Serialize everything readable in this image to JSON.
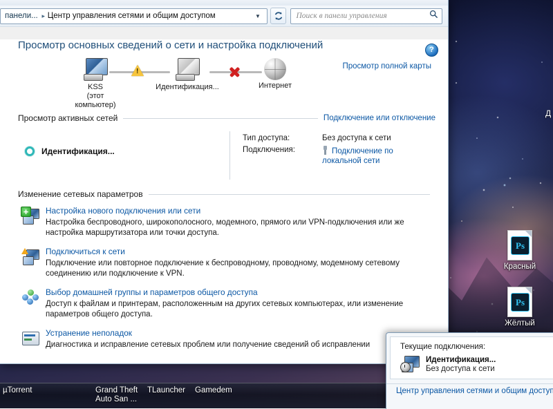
{
  "window": {
    "address": {
      "crumb_prefix": "панели...",
      "crumb_separator": "▸",
      "crumb_current": "Центр управления сетями и общим доступом",
      "dropdown_icon": "chevron-down-icon",
      "refresh_icon": "refresh-icon"
    },
    "search": {
      "placeholder": "Поиск в панели управления",
      "icon": "search-icon"
    },
    "help_label": "?",
    "page_title": "Просмотр основных сведений о сети и настройка подключений"
  },
  "netmap": {
    "full_map_link": "Просмотр полной карты",
    "nodes": [
      {
        "caption": "KSS\n(этот компьютер)",
        "icon": "computer-icon"
      },
      {
        "caption": "Идентификация...",
        "icon": "multiple-computers-icon"
      },
      {
        "caption": "Интернет",
        "icon": "globe-icon"
      }
    ],
    "link_status": [
      {
        "icon": "warning-icon",
        "label": "warning"
      },
      {
        "icon": "red-x-icon",
        "label": "no-connection"
      }
    ]
  },
  "active_networks": {
    "heading": "Просмотр активных сетей",
    "side_link": "Подключение или отключение",
    "network_name": "Идентификация...",
    "network_icon": "identifying-ring-icon",
    "rows": [
      {
        "key": "Тип доступа:",
        "value": "Без доступа к сети",
        "is_link": false
      },
      {
        "key": "Подключения:",
        "value": "Подключение по локальной сети",
        "is_link": true,
        "icon": "network-plug-icon"
      }
    ]
  },
  "settings": {
    "heading": "Изменение сетевых параметров",
    "items": [
      {
        "icon": "new-connection-icon",
        "title": "Настройка нового подключения или сети",
        "desc": "Настройка беспроводного, широкополосного, модемного, прямого или VPN-подключения или же настройка маршрутизатора или точки доступа."
      },
      {
        "icon": "connect-to-network-icon",
        "title": "Подключиться к сети",
        "desc": "Подключение или повторное подключение к беспроводному, проводному, модемному сетевому соединению или подключение к VPN."
      },
      {
        "icon": "homegroup-icon",
        "title": "Выбор домашней группы и параметров общего доступа",
        "desc": "Доступ к файлам и принтерам, расположенным на других сетевых компьютерах, или изменение параметров общего доступа."
      },
      {
        "icon": "troubleshoot-icon",
        "title": "Устранение неполадок",
        "desc": "Диагностика и исправление сетевых проблем или получение сведений об исправлении"
      }
    ]
  },
  "flyout": {
    "heading": "Текущие подключения:",
    "connection_name": "Идентификация...",
    "connection_status": "Без доступа к сети",
    "connection_icon": "network-connection-icon",
    "footer_link": "Центр управления сетями и общим доступу"
  },
  "desktop": {
    "edge_text": "Д",
    "icons": [
      {
        "label": "Красный",
        "badge": "Ps",
        "type": "photoshop-file-icon"
      },
      {
        "label": "Жёлтый",
        "badge": "Ps",
        "type": "photoshop-file-icon"
      }
    ]
  },
  "taskbar": {
    "items": [
      {
        "label": "µTorrent"
      },
      {
        "label": "Grand Theft\nAuto San ..."
      },
      {
        "label": "TLauncher"
      },
      {
        "label": "Gamedem"
      }
    ]
  },
  "colors": {
    "link": "#0b57a4",
    "title": "#1f4e79",
    "warning": "#f7c53d",
    "error": "#d02121",
    "identifying": "#2fb8b8"
  }
}
